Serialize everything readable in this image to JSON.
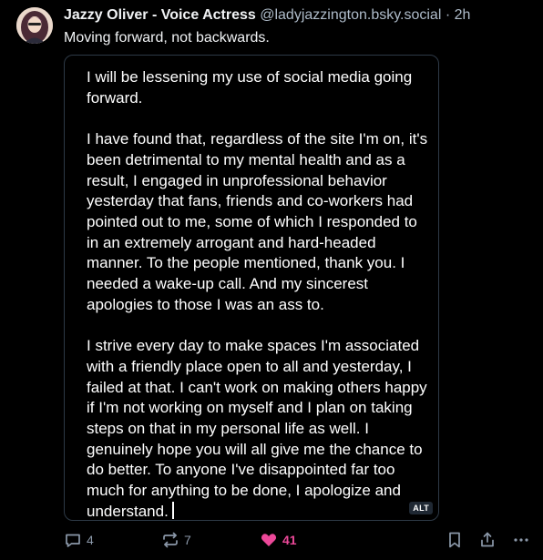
{
  "post": {
    "author_name": "Jazzy Oliver - Voice Actress",
    "author_handle": "@ladyjazzington.bsky.social",
    "separator": " · ",
    "time": "2h",
    "text": "Moving forward, not backwards."
  },
  "image": {
    "paragraphs": [
      "I will be lessening my use of social media going forward.",
      "I have found that, regardless of the site I'm on, it's been detrimental to my mental health and as a result, I engaged in unprofessional behavior yesterday that fans, friends and co-workers had pointed out to me, some of which I responded to in an extremely arrogant and hard-headed manner. To the people mentioned, thank you. I needed a wake-up call. And my sincerest apologies to those I was an ass to.",
      "I strive every day to make spaces I'm associated with a friendly place open to all and yesterday, I failed at that. I can't work on making others happy if I'm not working on myself and I plan on taking steps on that in my personal life as well. I genuinely hope you will all give me the chance to do better. To anyone I've disappointed far too much for anything to be done, I apologize and understand."
    ],
    "alt_badge": "ALT"
  },
  "actions": {
    "reply_count": "4",
    "repost_count": "7",
    "like_count": "41",
    "icons": [
      "reply-icon",
      "repost-icon",
      "heart-icon",
      "bookmark-icon",
      "share-icon",
      "more-icon"
    ]
  },
  "colors": {
    "background": "#000000",
    "text": "#f1f3f5",
    "muted": "#aebbc9",
    "like": "#ec4899",
    "border": "#2e3a47"
  }
}
